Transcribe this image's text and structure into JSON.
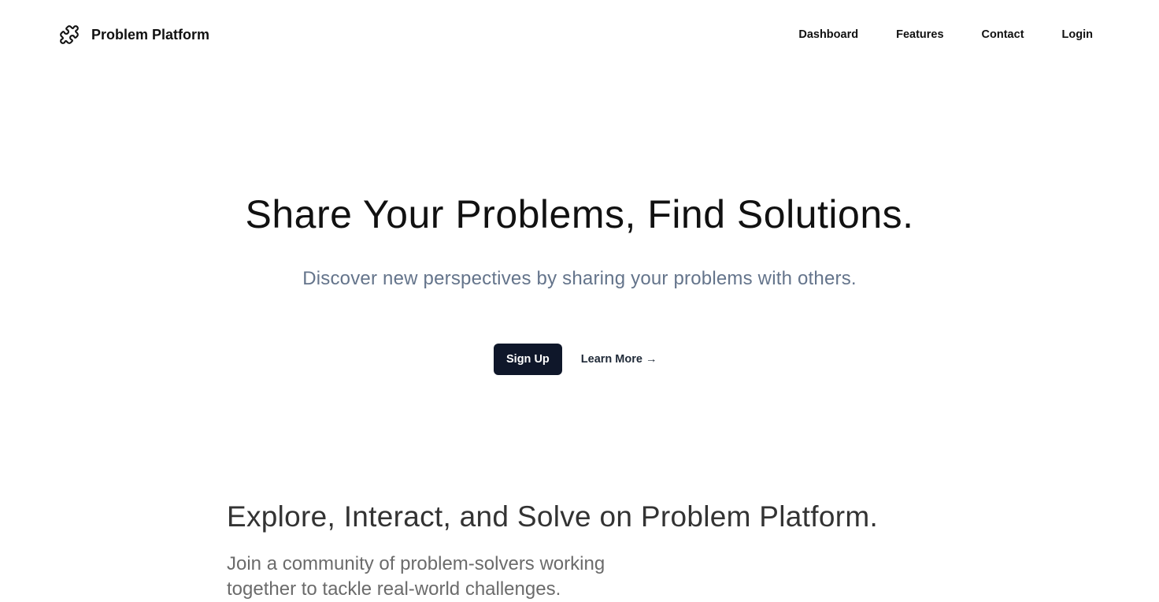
{
  "nav": {
    "brand": {
      "icon": "puzzle-icon",
      "name": "Problem Platform"
    },
    "links": [
      {
        "label": "Dashboard"
      },
      {
        "label": "Features"
      },
      {
        "label": "Contact"
      },
      {
        "label": "Login"
      }
    ]
  },
  "hero": {
    "title": "Share Your Problems, Find Solutions.",
    "subtitle": "Discover new perspectives by sharing your problems with others.",
    "primary_button": "Sign Up",
    "secondary_link": "Learn More →"
  },
  "explore": {
    "title": "Explore, Interact, and Solve on Problem Platform.",
    "text": "Join a community of problem-solvers working together to tackle real-world challenges."
  },
  "colors": {
    "primary_button_bg": "#0f172a",
    "subtitle_text": "#64748b",
    "background": "#ffffff"
  }
}
